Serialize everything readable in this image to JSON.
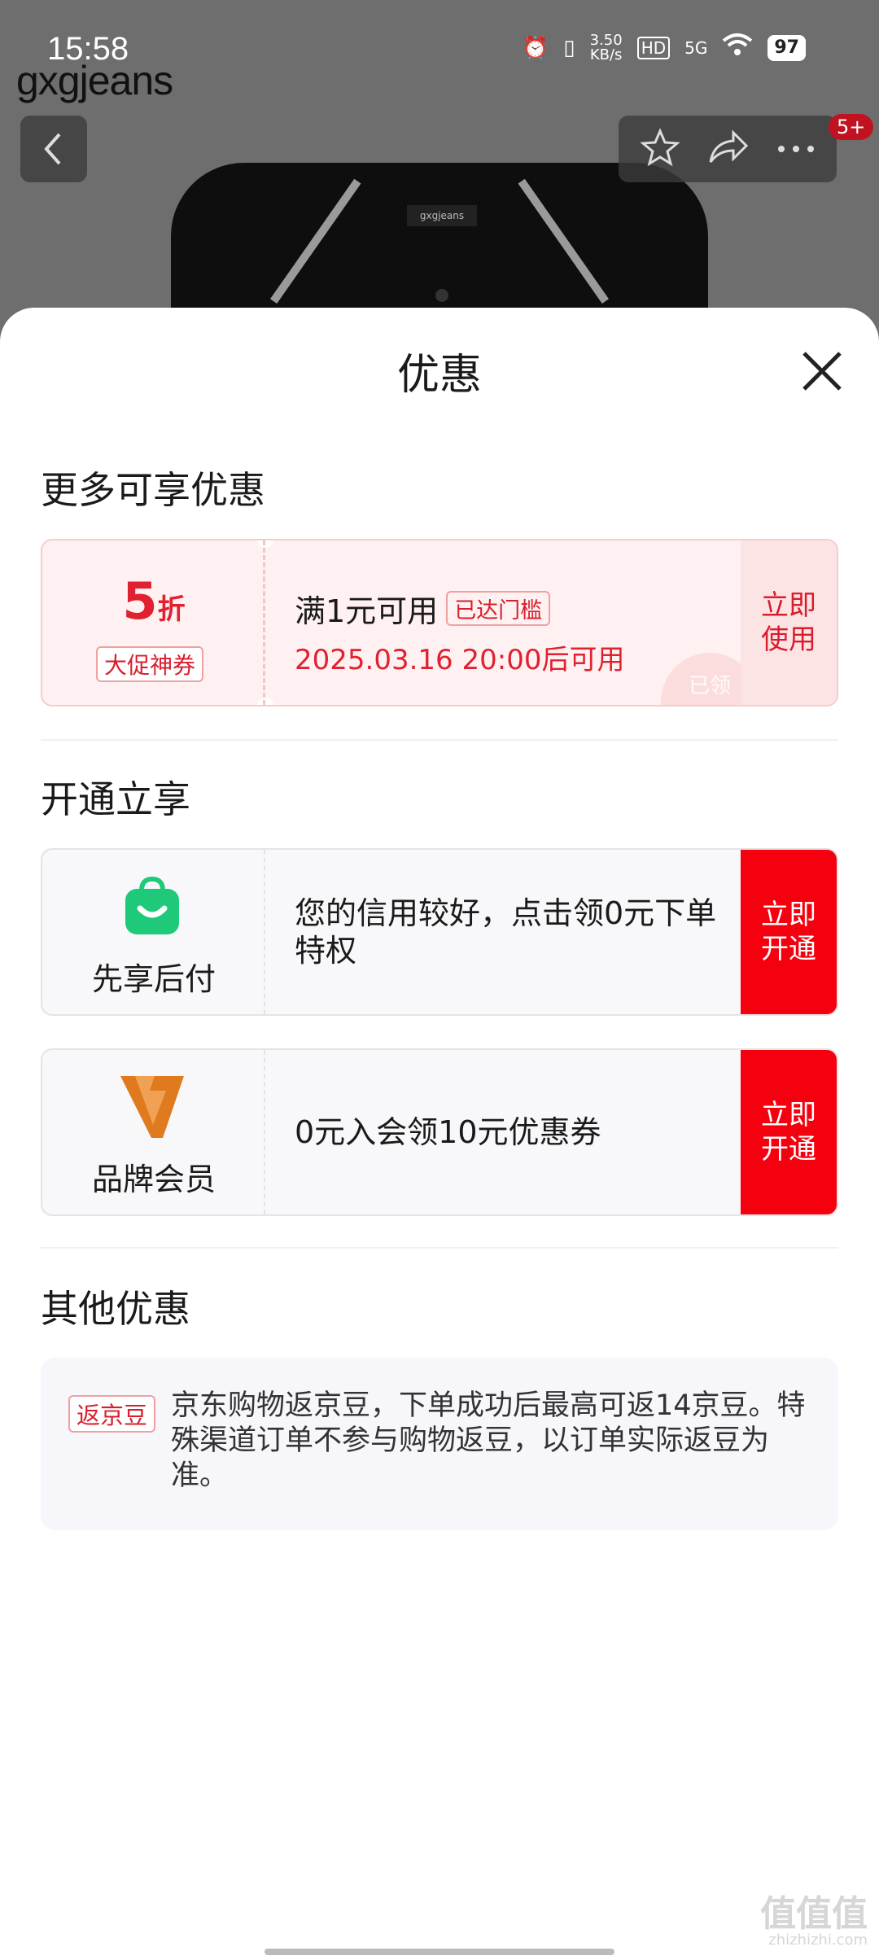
{
  "status_bar": {
    "time": "15:58",
    "net_speed_value": "3.50",
    "net_speed_unit": "KB/s",
    "hd": "HD",
    "network": "5G",
    "battery": "97"
  },
  "background_page": {
    "brand": "gxgjeans",
    "shirt_label": "gxgjeans",
    "cart_badge": "5+"
  },
  "sheet": {
    "title": "优惠",
    "sections": {
      "more": "更多可享优惠",
      "open": "开通立享",
      "other": "其他优惠"
    },
    "coupon": {
      "discount_number": "5",
      "discount_unit": "折",
      "tag": "大促神券",
      "condition": "满1元可用",
      "reached": "已达门槛",
      "valid_time": "2025.03.16 20:00后可用",
      "action": "立即使用",
      "stamp": "已领"
    },
    "open_items": [
      {
        "label": "先享后付",
        "desc": "您的信用较好，点击领0元下单特权",
        "action": "立即开通"
      },
      {
        "label": "品牌会员",
        "desc": "0元入会领10元优惠券",
        "action": "立即开通"
      }
    ],
    "other_offer": {
      "tag": "返京豆",
      "text": "京东购物返京豆，下单成功后最高可返14京豆。特殊渠道订单不参与购物返豆，以订单实际返豆为准。"
    }
  },
  "watermark": {
    "main": "值值值",
    "sub": "zhizhizhi.com"
  },
  "colors": {
    "accent_red": "#f5000f",
    "coupon_red": "#e0212f",
    "green_icon": "#1fc97a",
    "member_orange": "#e07a1f"
  }
}
